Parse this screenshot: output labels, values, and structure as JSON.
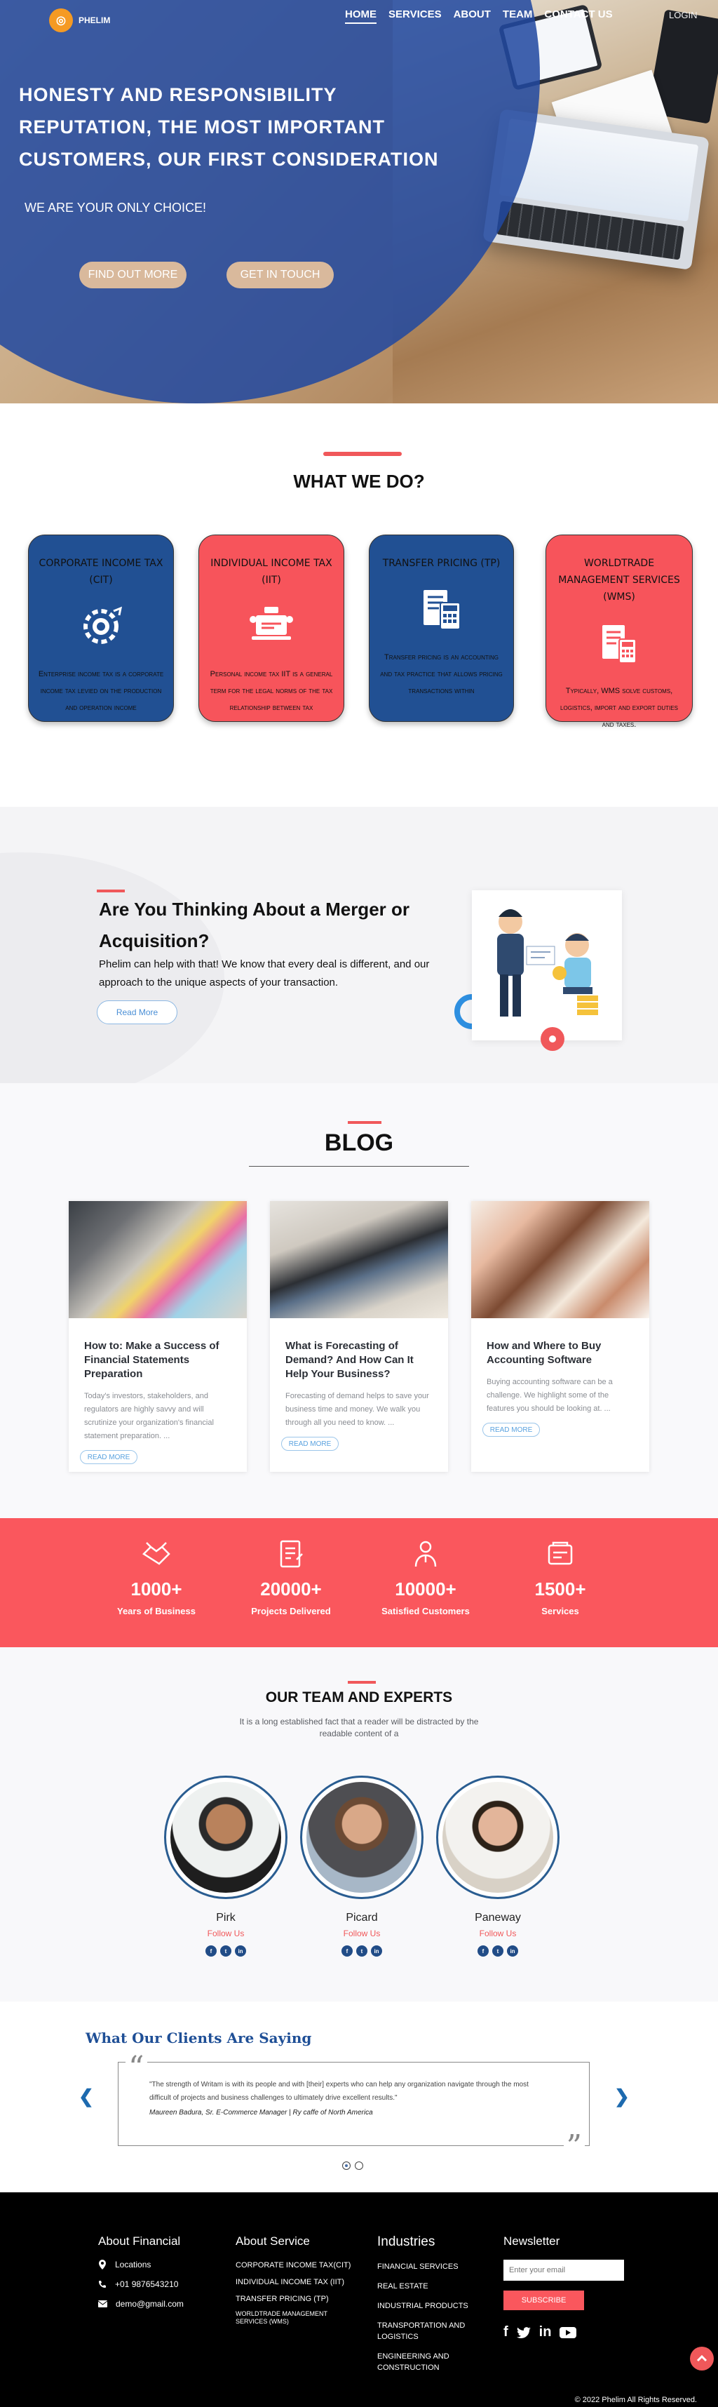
{
  "brand": {
    "name": "PHELIM"
  },
  "nav": {
    "items": [
      "HOME",
      "SERVICES",
      "ABOUT",
      "TEAM",
      "CONTACT US"
    ],
    "login": "LOGIN"
  },
  "hero": {
    "title_lines": [
      "HONESTY AND RESPONSIBILITY",
      "REPUTATION, THE MOST IMPORTANT",
      "CUSTOMERS, OUR FIRST CONSIDERATION"
    ],
    "subtitle": "WE ARE YOUR ONLY CHOICE!",
    "btn_find": "FIND OUT MORE",
    "btn_touch": "GET IN TOUCH"
  },
  "what_we_do": {
    "title": "WHAT WE DO?",
    "services": [
      {
        "title": "CORPORATE INCOME TAX (CIT)",
        "desc": "Enterprise income tax is a corporate income tax levied on the production and operation income",
        "icon": "gear-globe-icon",
        "color": "#215093"
      },
      {
        "title": "INDIVIDUAL INCOME TAX (IIT)",
        "desc": "Personal income tax IIT is a general term for the legal norms of the tax relationship between tax",
        "icon": "laptop-people-icon",
        "color": "#f7545b"
      },
      {
        "title": "TRANSFER PRICING (TP)",
        "desc": "Transfer pricing is an accounting and tax practice that allows pricing transactions within",
        "icon": "calculator-document-icon",
        "color": "#215093"
      },
      {
        "title": "WORLDTRADE MANAGEMENT SERVICES (WMS)",
        "desc": "Typically, WMS solve customs, logistics, import and export duties and taxes.",
        "icon": "ledger-calculator-icon",
        "color": "#f7545b"
      }
    ]
  },
  "merger": {
    "title": "Are You Thinking About a Merger or Acquisition?",
    "text": "Phelim  can help with that! We know that every deal is different, and our approach to the unique aspects of your transaction.",
    "button": "Read More"
  },
  "blog": {
    "title": "BLOG",
    "posts": [
      {
        "title": "How to: Make a Success of Financial Statements Preparation",
        "excerpt": "Today's investors, stakeholders, and regulators are highly savvy and will scrutinize your organization's financial statement preparation. ...",
        "more": "READ MORE"
      },
      {
        "title": "What is Forecasting of Demand? And How Can It Help Your Business?",
        "excerpt": "Forecasting of demand helps to save your business time and money. We walk you through all you need to know. ...",
        "more": "READ MORE"
      },
      {
        "title": "How and Where to Buy Accounting Software",
        "excerpt": "Buying accounting software can be a challenge. We highlight some of the features you should be looking at. ...",
        "more": "READ MORE"
      }
    ]
  },
  "stats": [
    {
      "value": "1000+",
      "label": "Years of Business",
      "icon": "handshake-icon"
    },
    {
      "value": "20000+",
      "label": "Projects Delivered",
      "icon": "document-icon"
    },
    {
      "value": "10000+",
      "label": "Satisfied Customers",
      "icon": "customer-icon"
    },
    {
      "value": "1500+",
      "label": "Services",
      "icon": "services-icon"
    }
  ],
  "team": {
    "title": "OUR TEAM AND EXPERTS",
    "subtitle": "It is a long established fact that a reader will be distracted by the readable content of a",
    "follow_label": "Follow Us",
    "members": [
      {
        "name": "Pirk"
      },
      {
        "name": "Picard"
      },
      {
        "name": "Paneway"
      }
    ]
  },
  "testimonials": {
    "title": "What Our Clients Are Saying",
    "quote": "\"The strength of Writam is with its people and with [their] experts who can help any organization navigate through the most difficult of projects and business challenges to ultimately drive excellent results.\"",
    "author": "Maureen Badura, Sr. E-Commerce Manager | Ry caffe of North America"
  },
  "footer": {
    "about": {
      "title": "About Financial",
      "locations": "Locations",
      "phone": "+01 9876543210",
      "email": "demo@gmail.com"
    },
    "about_service": {
      "title": "About Service",
      "links": [
        "CORPORATE INCOME TAX(CIT)",
        "INDIVIDUAL INCOME TAX (IIT)",
        "TRANSFER PRICING (TP)",
        "WORLDTRADE MANAGEMENT SERVICES (WMS)"
      ]
    },
    "industries": {
      "title": "Industries",
      "links": [
        "FINANCIAL SERVICES",
        "REAL ESTATE",
        "INDUSTRIAL PRODUCTS",
        "TRANSPORTATION AND LOGISTICS",
        "ENGINEERING AND CONSTRUCTION"
      ]
    },
    "newsletter": {
      "title": "Newsletter",
      "placeholder": "Enter your email",
      "button": "SUBSCRIBE"
    },
    "copyright": "© 2022 Phelim All Rights Reserved."
  },
  "colors": {
    "primary_blue": "#215093",
    "accent_red": "#f7545b",
    "footer_bg": "#000000"
  }
}
